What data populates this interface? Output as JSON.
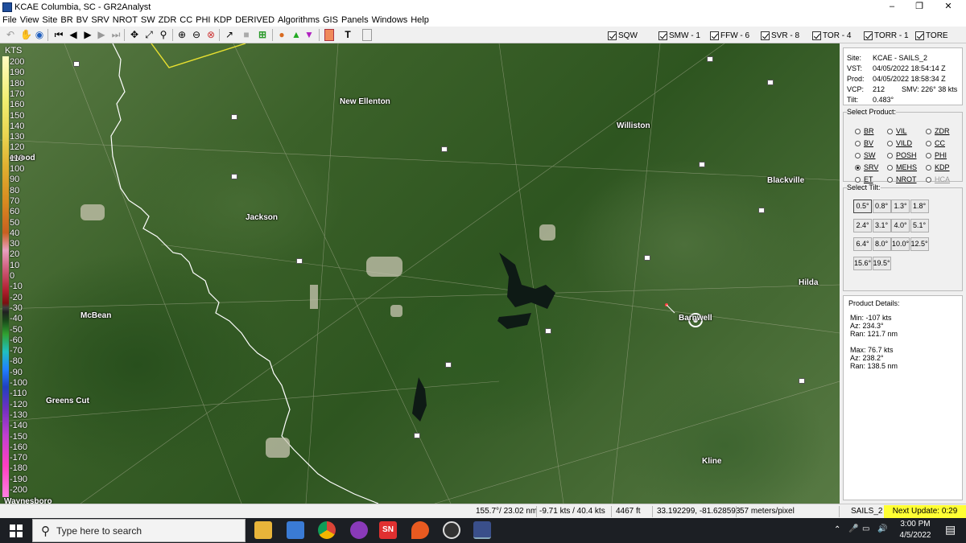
{
  "window": {
    "title": "KCAE Columbia, SC - GR2Analyst",
    "minimize": "–",
    "maximize": "❐",
    "close": "✕"
  },
  "menu": [
    "File",
    "View",
    "Site",
    "BR",
    "BV",
    "SRV",
    "NROT",
    "SW",
    "ZDR",
    "CC",
    "PHI",
    "KDP",
    "DERIVED",
    "Algorithms",
    "GIS",
    "Panels",
    "Windows",
    "Help"
  ],
  "toolbar": {
    "icons": [
      "back-icon",
      "hand-icon",
      "globe-icon",
      "first-frame-icon",
      "prev-frame-icon",
      "play-icon",
      "next-frame-icon",
      "last-frame-icon",
      "move-icon",
      "cross-section-icon",
      "measure-icon",
      "zoom-in-icon",
      "zoom-out-icon",
      "zoom-reset-icon",
      "pin-icon",
      "stop-icon",
      "split-icon",
      "palette-icon",
      "up-triangle-icon",
      "down-triangle-icon",
      "color-swatch-icon",
      "text-icon",
      "frame-icon"
    ],
    "warnings": [
      {
        "label": "SQW"
      },
      {
        "label": "SMW - 1"
      },
      {
        "label": "FFW - 6"
      },
      {
        "label": "SVR - 8"
      },
      {
        "label": "TOR - 4"
      },
      {
        "label": "TORR - 1"
      },
      {
        "label": "TORE"
      }
    ]
  },
  "colorscale": {
    "unit": "KTS",
    "labels": [
      "200",
      "190",
      "180",
      "170",
      "160",
      "150",
      "140",
      "130",
      "120",
      "110",
      "100",
      "90",
      "80",
      "70",
      "60",
      "50",
      "40",
      "30",
      "20",
      "10",
      "0",
      "-10",
      "-20",
      "-30",
      "-40",
      "-50",
      "-60",
      "-70",
      "-80",
      "-90",
      "-100",
      "-110",
      "-120",
      "-130",
      "-140",
      "-150",
      "-160",
      "-170",
      "-180",
      "-190",
      "-200"
    ]
  },
  "map": {
    "towns": [
      "New Ellenton",
      "Williston",
      "Blackville",
      "Jackson",
      "Hilda",
      "McBean",
      "Barnwell",
      "Greens Cut",
      "Kline",
      "Waynesboro",
      "ewood"
    ]
  },
  "site_info": {
    "site_k": "Site:",
    "site_v": "KCAE - SAILS_2",
    "vst_k": "VST:",
    "vst_v": "04/05/2022  18:54:14 Z",
    "prod_k": "Prod:",
    "prod_v": "04/05/2022  18:58:34 Z",
    "vcp_k": "VCP:",
    "vcp_v": "212",
    "smv": "SMV: 226° 38 kts",
    "tilt_k": "Tilt:",
    "tilt_v": "0.483°"
  },
  "select_product": {
    "legend": "Select Product:",
    "options": [
      "BR",
      "VIL",
      "ZDR",
      "BV",
      "VILD",
      "CC",
      "SW",
      "POSH",
      "PHI",
      "SRV",
      "MEHS",
      "KDP",
      "ET",
      "NROT",
      "HCA"
    ],
    "selected": "SRV"
  },
  "select_tilt": {
    "legend": "Select Tilt:",
    "tilts": [
      "0.5°",
      "0.8°",
      "1.3°",
      "1.8°",
      "2.4°",
      "3.1°",
      "4.0°",
      "5.1°",
      "6.4°",
      "8.0°",
      "10.0°",
      "12.5°",
      "15.6°",
      "19.5°"
    ],
    "selected": "0.5°"
  },
  "product_details": {
    "legend": "Product Details:",
    "min": "Min:  -107 kts",
    "min_az": "Az:  234.3°",
    "min_ran": "Ran:  121.7 nm",
    "max": "Max:  76.7 kts",
    "max_az": "Az:  238.2°",
    "max_ran": "Ran:  138.5 nm"
  },
  "status": {
    "azran": "155.7°/ 23.02 nm",
    "vel": "-9.71 kts / 40.4 kts",
    "height": "4467 ft",
    "coords": "33.192299, -81.628593",
    "scale": "57 meters/pixel",
    "mode": "SAILS_2",
    "next_update": "Next Update: 0:29"
  },
  "taskbar": {
    "search_placeholder": "Type here to search",
    "time": "3:00 PM",
    "date": "4/5/2022",
    "apps": [
      "file-explorer-icon",
      "store-icon",
      "chrome-icon",
      "podcast-icon",
      "sn-icon",
      "maps-pin-icon",
      "obs-icon",
      "gr2analyst-icon"
    ]
  }
}
